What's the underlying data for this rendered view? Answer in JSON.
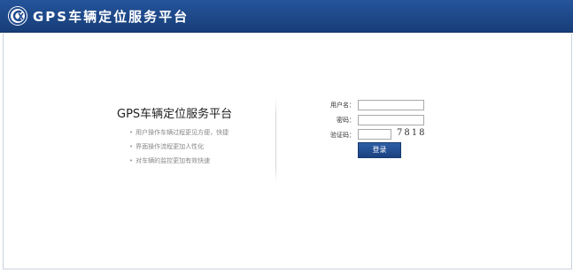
{
  "header": {
    "title": "GPS车辆定位服务平台",
    "logo_icon": "gps-logo-icon"
  },
  "intro": {
    "title": "GPS车辆定位服务平台",
    "bullet": "•",
    "items": [
      "用户操作车辆过程更见方便，快捷",
      "界面操作流程更加人性化",
      "对车辆的监控更加有效快速"
    ]
  },
  "login_form": {
    "username_label": "用户名：",
    "username_value": "",
    "password_label": "密码：",
    "password_value": "",
    "captcha_label": "验证码：",
    "captcha_value": "",
    "captcha_code": "7818",
    "login_label": "登录"
  },
  "colors": {
    "header_bg": "#1f4a8c",
    "button_bg": "#1f4a8c"
  }
}
